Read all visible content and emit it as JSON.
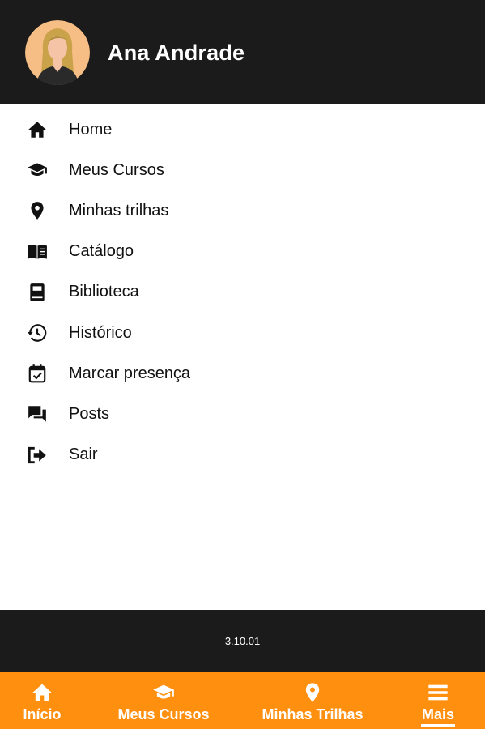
{
  "header": {
    "user_name": "Ana Andrade"
  },
  "menu": {
    "items": [
      {
        "label": "Home",
        "icon": "home-icon"
      },
      {
        "label": "Meus Cursos",
        "icon": "graduation-cap-icon"
      },
      {
        "label": "Minhas trilhas",
        "icon": "map-pin-icon"
      },
      {
        "label": "Catálogo",
        "icon": "open-book-icon"
      },
      {
        "label": "Biblioteca",
        "icon": "book-icon"
      },
      {
        "label": "Histórico",
        "icon": "history-icon"
      },
      {
        "label": "Marcar presença",
        "icon": "calendar-check-icon"
      },
      {
        "label": "Posts",
        "icon": "chat-bubbles-icon"
      },
      {
        "label": "Sair",
        "icon": "logout-icon"
      }
    ]
  },
  "footer": {
    "version": "3.10.01"
  },
  "bottom_nav": {
    "tabs": [
      {
        "label": "Início",
        "icon": "home-icon"
      },
      {
        "label": "Meus Cursos",
        "icon": "graduation-cap-icon"
      },
      {
        "label": "Minhas Trilhas",
        "icon": "map-pin-icon"
      },
      {
        "label": "Mais",
        "icon": "hamburger-menu-icon",
        "active": true
      }
    ]
  },
  "colors": {
    "header_bg": "#1b1b1b",
    "accent": "#ff8f0f",
    "text": "#111111"
  }
}
